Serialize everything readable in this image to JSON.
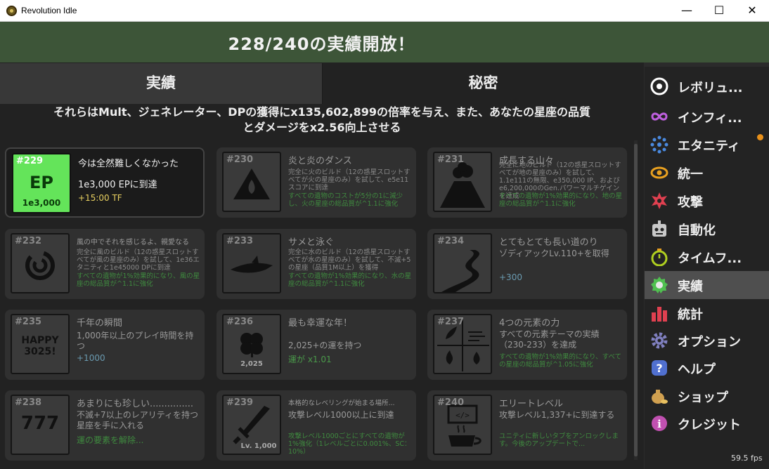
{
  "window": {
    "title": "Revolution Idle",
    "minimize": "—",
    "maximize": "☐",
    "close": "✕"
  },
  "header": {
    "text": "228/240の実績開放！"
  },
  "tabs": [
    {
      "label": "実績",
      "active": true
    },
    {
      "label": "秘密",
      "active": false
    }
  ],
  "description": {
    "line1": "それらはMult、ジェネレーター、DPの獲得にx135,602,899の倍率を与え、また、あなたの星座の品質",
    "line2": "とダメージをx2.56向上させる"
  },
  "achievements": [
    {
      "num": "#229",
      "title": "今は全然難しくなかった",
      "desc": "1e3,000 EPに到達",
      "reward": "+15:00 TF",
      "icon": "ep-icon",
      "icon_text": "EP",
      "icon_sub": "1e3,000",
      "unlocked": true
    },
    {
      "num": "#230",
      "title": "炎と炎のダンス",
      "desc": "完全に火のビルド（12の惑星スロットすべてが火の星座のみ）を試して、e5e11スコアに到達",
      "reward": "すべての遺物のコストが5分の1に減少し、火の星座の総品質が^1.1に強化",
      "icon": "fire-icon",
      "unlocked": false
    },
    {
      "num": "#231",
      "title": "成長する山々",
      "desc": "完全に地のビルド（12の惑星スロットすべてが地の星座のみ）を試して、1.1e111の無限、e350,000 IP、およびe6,200,000のGen.パワーマルチゲインを達成",
      "reward": "すべての遺物が1%効果的になり、地の星座の総品質が^1.1に強化",
      "icon": "volcano-icon",
      "unlocked": false
    },
    {
      "num": "#232",
      "title": "風の中でそれを感じるよ、親愛なる",
      "desc": "完全に風のビルド（12の惑星スロットすべてが風の星座のみ）を試して、1e36エタニティと1e45000 DPに到達",
      "reward": "すべての遺物が1%効果的になり、風の星座の総品質が^1.1に強化",
      "icon": "swirl-icon",
      "unlocked": false
    },
    {
      "num": "#233",
      "title": "サメと泳ぐ",
      "desc": "完全に水のビルド（12の惑星スロットすべてが水の星座のみ）を試して、不滅+5の星座（品質1M以上）を獲得",
      "reward": "すべての遺物が1%効果的になり、水の星座の総品質が^1.1に強化",
      "icon": "shark-icon",
      "unlocked": false
    },
    {
      "num": "#234",
      "title": "とてもとても長い道のり",
      "desc": "ゾディアックLv.110+を取得",
      "reward": "+300",
      "icon": "road-icon",
      "unlocked": false
    },
    {
      "num": "#235",
      "title": "千年の瞬間",
      "desc": "1,000年以上のプレイ時間を持つ",
      "reward": "+1000",
      "icon": "happy-icon",
      "icon_text": "HAPPY\n3025!",
      "unlocked": false
    },
    {
      "num": "#236",
      "title": "最も幸運な年！",
      "desc": "2,025+の運を持つ",
      "reward": "運が x1.01",
      "icon": "clover-icon",
      "icon_sub": "2,025",
      "unlocked": false
    },
    {
      "num": "#237",
      "title": "4つの元素の力",
      "desc": "すべての元素テーマの実績（230-233）を達成",
      "reward": "すべての遺物が1%効果的になり、すべての星座の総品質が^1.05に強化",
      "icon": "elements-icon",
      "unlocked": false
    },
    {
      "num": "#238",
      "title": "あまりにも珍しい...............",
      "desc": "不滅+7以上のレアリティを持つ星座を手に入れる",
      "reward": "運の要素を解除...",
      "icon": "slot-icon",
      "icon_text": "777",
      "unlocked": false
    },
    {
      "num": "#239",
      "title": "本格的なレベリングが始まる場所...",
      "desc": "攻撃レベル1000以上に到達",
      "reward": "攻撃レベル1000ごとにすべての遺物が1%強化（1レベルごとに0.001%、SC：10%）",
      "icon": "sword-icon",
      "icon_sub": "Lv. 1,000",
      "unlocked": false
    },
    {
      "num": "#240",
      "title": "エリートレベル",
      "desc": "攻撃レベル1,337+に到達する",
      "reward": "ユニティに新しいタブをアンロックします。今後のアップデートで...",
      "icon": "coffee-icon",
      "unlocked": false
    }
  ],
  "sidebar": [
    {
      "label": "レボリュ...",
      "icon": "revolution-icon",
      "color": "#ffffff"
    },
    {
      "label": "インフィ...",
      "icon": "infinity-icon",
      "color": "#c060e0"
    },
    {
      "label": "エタニティ",
      "icon": "eternity-icon",
      "color": "#4a8ae0",
      "badge": true
    },
    {
      "label": "統一",
      "icon": "unity-icon",
      "color": "#e8a020"
    },
    {
      "label": "攻撃",
      "icon": "attack-icon",
      "color": "#e04050"
    },
    {
      "label": "自動化",
      "icon": "robot-icon",
      "color": "#c8c8c8"
    },
    {
      "label": "タイムフ...",
      "icon": "stopwatch-icon",
      "color": "#b0d020"
    },
    {
      "label": "実績",
      "icon": "medal-icon",
      "color": "#50c050",
      "active": true
    },
    {
      "label": "統計",
      "icon": "stats-icon",
      "color": "#e04050"
    },
    {
      "label": "オプション",
      "icon": "gear-icon",
      "color": "#8080c0"
    },
    {
      "label": "ヘルプ",
      "icon": "help-icon",
      "color": "#5070d0"
    },
    {
      "label": "ショップ",
      "icon": "moneybag-icon",
      "color": "#d0a050"
    },
    {
      "label": "クレジット",
      "icon": "info-icon",
      "color": "#c050b0"
    }
  ],
  "fps": "59.5 fps"
}
